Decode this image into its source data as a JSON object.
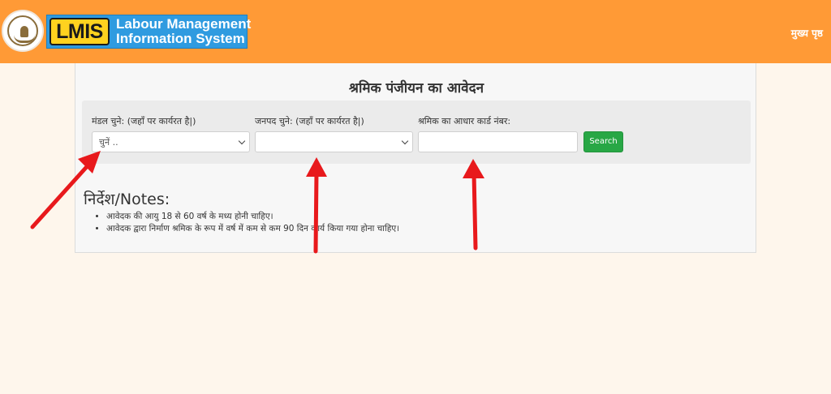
{
  "header": {
    "logo_short": "LMIS",
    "logo_line1": "Labour Management",
    "logo_line2": "Information System",
    "home_link": "मुख्य पृष्ठ",
    "bg_color": "#ff9a36"
  },
  "page": {
    "title": "श्रमिक पंजीयन का आवेदन"
  },
  "form": {
    "mandal_label": "मंडल चुने: (जहाँ पर कार्यरत है|)",
    "mandal_value": "चुनें ..",
    "janpad_label": "जनपद चुने: (जहाँ पर कार्यरत है|)",
    "janpad_value": "",
    "aadhaar_label": "श्रमिक का आधार कार्ड नंबर:",
    "aadhaar_value": "",
    "search_label": "Search",
    "search_color": "#28a745"
  },
  "notes": {
    "title": "निर्देश/Notes:",
    "items": [
      "आवेदक की आयु 18 से 60 वर्ष के मध्य होनी चाहिए।",
      "आवेदक द्वारा निर्माण श्रमिक के रूप में वर्ष में कम से कम 90 दिन कार्य किया गया होना चाहिए।"
    ]
  },
  "annotation": {
    "arrow_color": "#e8191c"
  }
}
